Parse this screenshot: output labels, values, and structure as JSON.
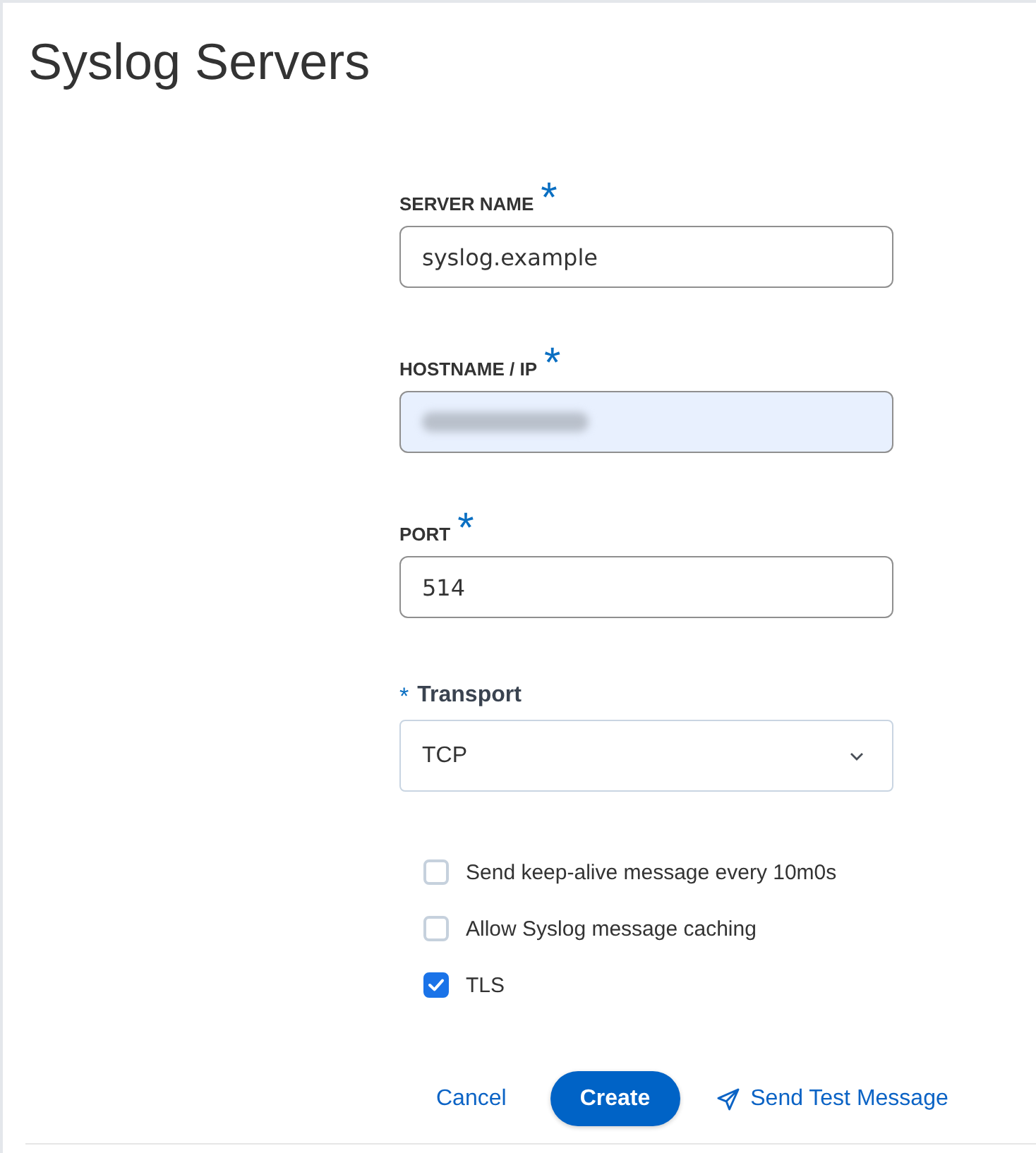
{
  "page": {
    "title": "Syslog Servers"
  },
  "form": {
    "fields": [
      {
        "kind": "text",
        "label": "SERVER NAME",
        "required_mark": "*",
        "autofilled": false,
        "value_hidden": false,
        "value": "syslog.example"
      },
      {
        "kind": "text",
        "label": "HOSTNAME / IP",
        "required_mark": "*",
        "autofilled": true,
        "value_hidden": true
      },
      {
        "kind": "text",
        "label": "PORT",
        "required_mark": "*",
        "autofilled": false,
        "value_hidden": false,
        "value": "514"
      },
      {
        "kind": "select",
        "label": "Transport",
        "required_mark": "*",
        "value": "TCP"
      }
    ],
    "options": [
      {
        "label": "Send keep-alive message every 10m0s",
        "checked": false
      },
      {
        "label": "Allow Syslog message caching",
        "checked": false
      },
      {
        "label": "TLS",
        "checked": true
      }
    ],
    "actions": [
      {
        "kind": "link",
        "label": "Cancel"
      },
      {
        "kind": "primary",
        "label": "Create"
      },
      {
        "kind": "icon_link",
        "label": "Send Test Message"
      }
    ]
  }
}
